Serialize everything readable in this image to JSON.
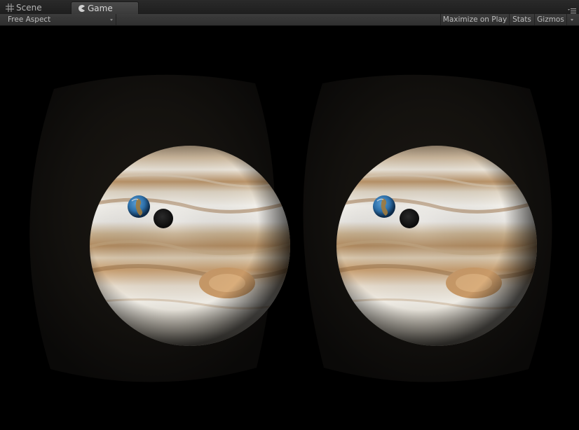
{
  "tabs": [
    {
      "label": "Scene",
      "icon": "grid-icon",
      "active": false
    },
    {
      "label": "Game",
      "icon": "pacman-icon",
      "active": true
    }
  ],
  "toolbar": {
    "aspect_label": "Free Aspect",
    "maximize_label": "Maximize on Play",
    "stats_label": "Stats",
    "gizmos_label": "Gizmos"
  },
  "colors": {
    "background": "#000000",
    "tab_bar": "#242424",
    "toolbar": "#343434",
    "lens_fill": "#0f0d0b",
    "jupiter_light": "#e8e4dc",
    "jupiter_band": "#b8946a",
    "earth_ocean": "#2d6fa8",
    "moon_shadow": "#111111"
  }
}
